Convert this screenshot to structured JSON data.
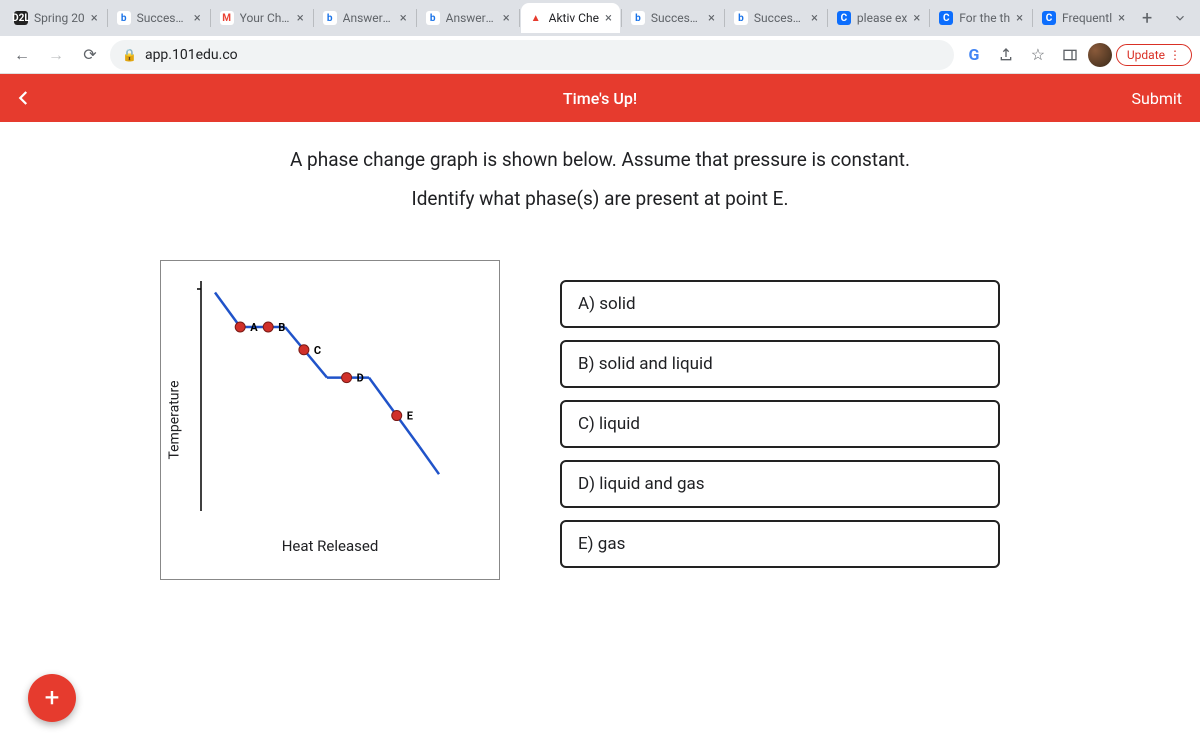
{
  "browser": {
    "tabs": [
      {
        "favicon_text": "D2L",
        "favicon_bg": "#222",
        "favicon_fg": "#fff",
        "title": "Spring 20"
      },
      {
        "favicon_text": "b",
        "favicon_bg": "#fff",
        "favicon_fg": "#1a73e8",
        "title": "Success C"
      },
      {
        "favicon_text": "M",
        "favicon_bg": "#fff",
        "favicon_fg": "#ea4335",
        "title": "Your Chec"
      },
      {
        "favicon_text": "b",
        "favicon_bg": "#fff",
        "favicon_fg": "#1a73e8",
        "title": "Answered"
      },
      {
        "favicon_text": "b",
        "favicon_bg": "#fff",
        "favicon_fg": "#1a73e8",
        "title": "Answered"
      },
      {
        "favicon_text": "▲",
        "favicon_bg": "#fff",
        "favicon_fg": "#e63b2e",
        "title": "Aktiv Che",
        "active": true
      },
      {
        "favicon_text": "b",
        "favicon_bg": "#fff",
        "favicon_fg": "#1a73e8",
        "title": "Success C"
      },
      {
        "favicon_text": "b",
        "favicon_bg": "#fff",
        "favicon_fg": "#1a73e8",
        "title": "Success C"
      },
      {
        "favicon_text": "C",
        "favicon_bg": "#0d6efd",
        "favicon_fg": "#fff",
        "title": "please ex"
      },
      {
        "favicon_text": "C",
        "favicon_bg": "#0d6efd",
        "favicon_fg": "#fff",
        "title": "For the th"
      },
      {
        "favicon_text": "C",
        "favicon_bg": "#0d6efd",
        "favicon_fg": "#fff",
        "title": "Frequentl"
      }
    ],
    "url": "app.101edu.co",
    "update_label": "Update"
  },
  "header": {
    "timer": "Time's Up!",
    "submit": "Submit"
  },
  "question": {
    "line1": "A phase change graph is shown below. Assume that pressure is constant.",
    "line2": "Identify what phase(s) are present at point E."
  },
  "choices": [
    "A) solid",
    "B) solid and liquid",
    "C) liquid",
    "D) liquid and gas",
    "E) gas"
  ],
  "chart_data": {
    "type": "line",
    "xlabel": "Heat Released",
    "ylabel": "Temperature",
    "points": [
      {
        "label": "A",
        "x": 10,
        "y": 85
      },
      {
        "label": "B",
        "x": 25,
        "y": 65
      },
      {
        "label": "C",
        "x": 42,
        "y": 50
      },
      {
        "label": "D",
        "x": 55,
        "y": 40
      },
      {
        "label": "E",
        "x": 72,
        "y": 20
      }
    ],
    "segments": [
      {
        "from": [
          5,
          95
        ],
        "to": [
          10,
          85
        ]
      },
      {
        "from": [
          10,
          85
        ],
        "to": [
          25,
          65
        ]
      },
      {
        "from": [
          25,
          65
        ],
        "to": [
          42,
          50
        ]
      },
      {
        "from": [
          42,
          50
        ],
        "to": [
          55,
          40
        ]
      },
      {
        "from": [
          55,
          40
        ],
        "to": [
          72,
          20
        ]
      },
      {
        "from": [
          72,
          20
        ],
        "to": [
          80,
          8
        ]
      }
    ],
    "plateau_indices": [
      1,
      3
    ]
  }
}
